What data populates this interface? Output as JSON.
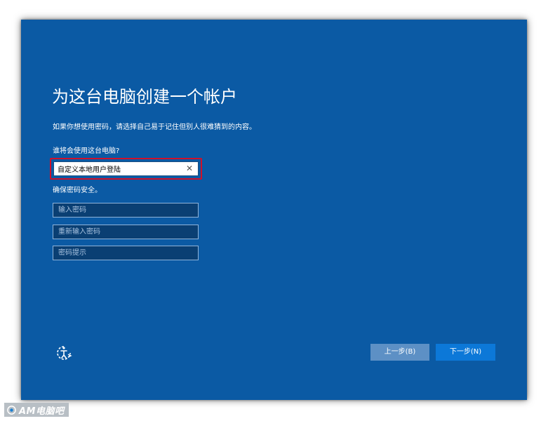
{
  "setup": {
    "title": "为这台电脑创建一个帐户",
    "subtitle": "如果你想使用密码，请选择自己易于记住但别人很难猜到的内容。",
    "user_label": "谁将会使用这台电脑?",
    "user_value": "自定义本地用户登陆",
    "password_label": "确保密码安全。",
    "password_placeholder": "输入密码",
    "confirm_placeholder": "重新输入密码",
    "hint_placeholder": "密码提示",
    "back_label": "上一步(B)",
    "next_label": "下一步(N)",
    "accessibility_icon": "ease-of-access-icon",
    "clear_icon": "clear-x-icon"
  },
  "watermark": {
    "text": "AM电脑吧",
    "icon": "watermark-logo-icon"
  },
  "colors": {
    "background": "#0b5aa4",
    "highlight": "#d0102a",
    "back_button": "#5d90c5",
    "next_button": "#0c78d8"
  }
}
